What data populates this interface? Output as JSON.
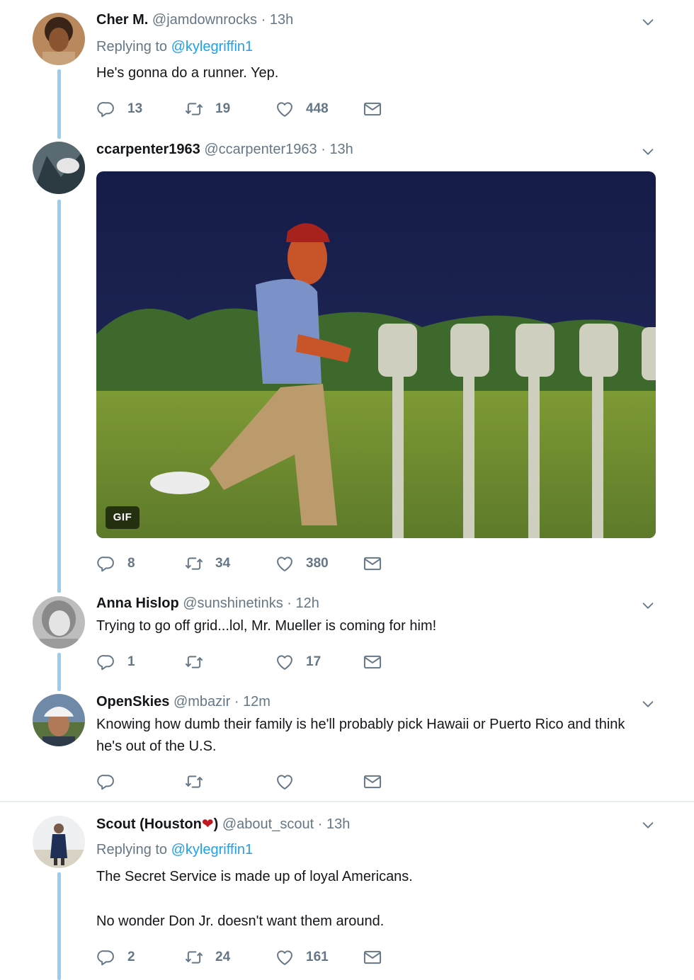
{
  "tweets": [
    {
      "name": "Cher M.",
      "handle": "@jamdownrocks",
      "time": "13h",
      "replying_label": "Replying to",
      "replying_to": "@kylegriffin1",
      "text": "He's gonna do a runner. Yep.",
      "replies": "13",
      "retweets": "19",
      "likes": "448"
    },
    {
      "name": "ccarpenter1963",
      "handle": "@ccarpenter1963",
      "time": "13h",
      "media_badge": "GIF",
      "replies": "8",
      "retweets": "34",
      "likes": "380"
    },
    {
      "name": "Anna Hislop",
      "handle": "@sunshinetinks",
      "time": "12h",
      "text": "Trying to go off grid...lol, Mr. Mueller is coming for him!",
      "replies": "1",
      "retweets": "",
      "likes": "17"
    },
    {
      "name": "OpenSkies",
      "handle": "@mbazir",
      "time": "12m",
      "text": "Knowing how dumb their family is he'll probably pick Hawaii or Puerto Rico and think he's out of the U.S.",
      "replies": "",
      "retweets": "",
      "likes": ""
    },
    {
      "name_prefix": "Scout (Houston",
      "name_emoji": "❤",
      "name_suffix": ")",
      "handle": "@about_scout",
      "time": "13h",
      "replying_label": "Replying to",
      "replying_to": "@kylegriffin1",
      "text_line1": "The Secret Service is made up of loyal Americans.",
      "text_line2": "No wonder Don Jr. doesn't want them around.",
      "replies": "2",
      "retweets": "24",
      "likes": "161"
    }
  ],
  "separator": "·",
  "icons": {
    "reply": "speech-bubble-icon",
    "retweet": "retweet-arrows-icon",
    "like": "heart-outline-icon",
    "dm": "envelope-icon",
    "more": "chevron-down-icon"
  },
  "colors": {
    "link": "#1da1f2",
    "thread_line": "#99cdea",
    "secondary_text": "#657786"
  }
}
